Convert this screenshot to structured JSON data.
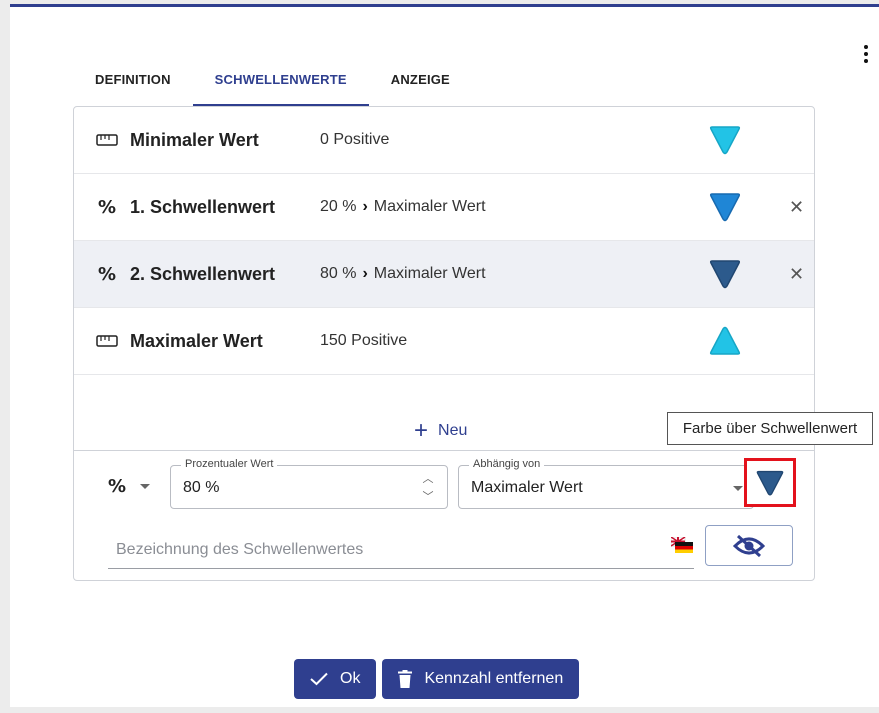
{
  "tabs": [
    {
      "label": "DEFINITION",
      "active": false
    },
    {
      "label": "SCHWELLENWERTE",
      "active": true
    },
    {
      "label": "ANZEIGE",
      "active": false
    }
  ],
  "thresholds": [
    {
      "icon": "ruler-icon",
      "title": "Minimaler Wert",
      "value": "0 Positive",
      "reference": "",
      "triangle": "down",
      "color": "#22c3e6",
      "removable": false
    },
    {
      "icon": "percent-icon",
      "title": "1. Schwellenwert",
      "value": "20 %",
      "reference": "Maximaler Wert",
      "triangle": "down",
      "color": "#1f86d6",
      "removable": true
    },
    {
      "icon": "percent-icon",
      "title": "2. Schwellenwert",
      "value": "80 %",
      "reference": "Maximaler Wert",
      "triangle": "down",
      "color": "#2c5a8c",
      "removable": true,
      "selected": true
    },
    {
      "icon": "ruler-icon",
      "title": "Maximaler Wert",
      "value": "150 Positive",
      "reference": "",
      "triangle": "up",
      "color": "#22c3e6",
      "removable": false
    }
  ],
  "new_button": {
    "label": "Neu"
  },
  "editor": {
    "type_symbol": "%",
    "percent_field": {
      "label": "Prozentualer Wert",
      "value": "80 %"
    },
    "depends_field": {
      "label": "Abhängig von",
      "value": "Maximaler Wert"
    },
    "color": "#2c5a8c",
    "tooltip": "Farbe über Schwellenwert",
    "name_placeholder": "Bezeichnung des Schwellenwertes"
  },
  "footer": {
    "ok_label": "Ok",
    "remove_label": "Kennzahl entfernen"
  },
  "colors": {
    "primary": "#2f3f8f",
    "highlight": "#e3121c"
  }
}
